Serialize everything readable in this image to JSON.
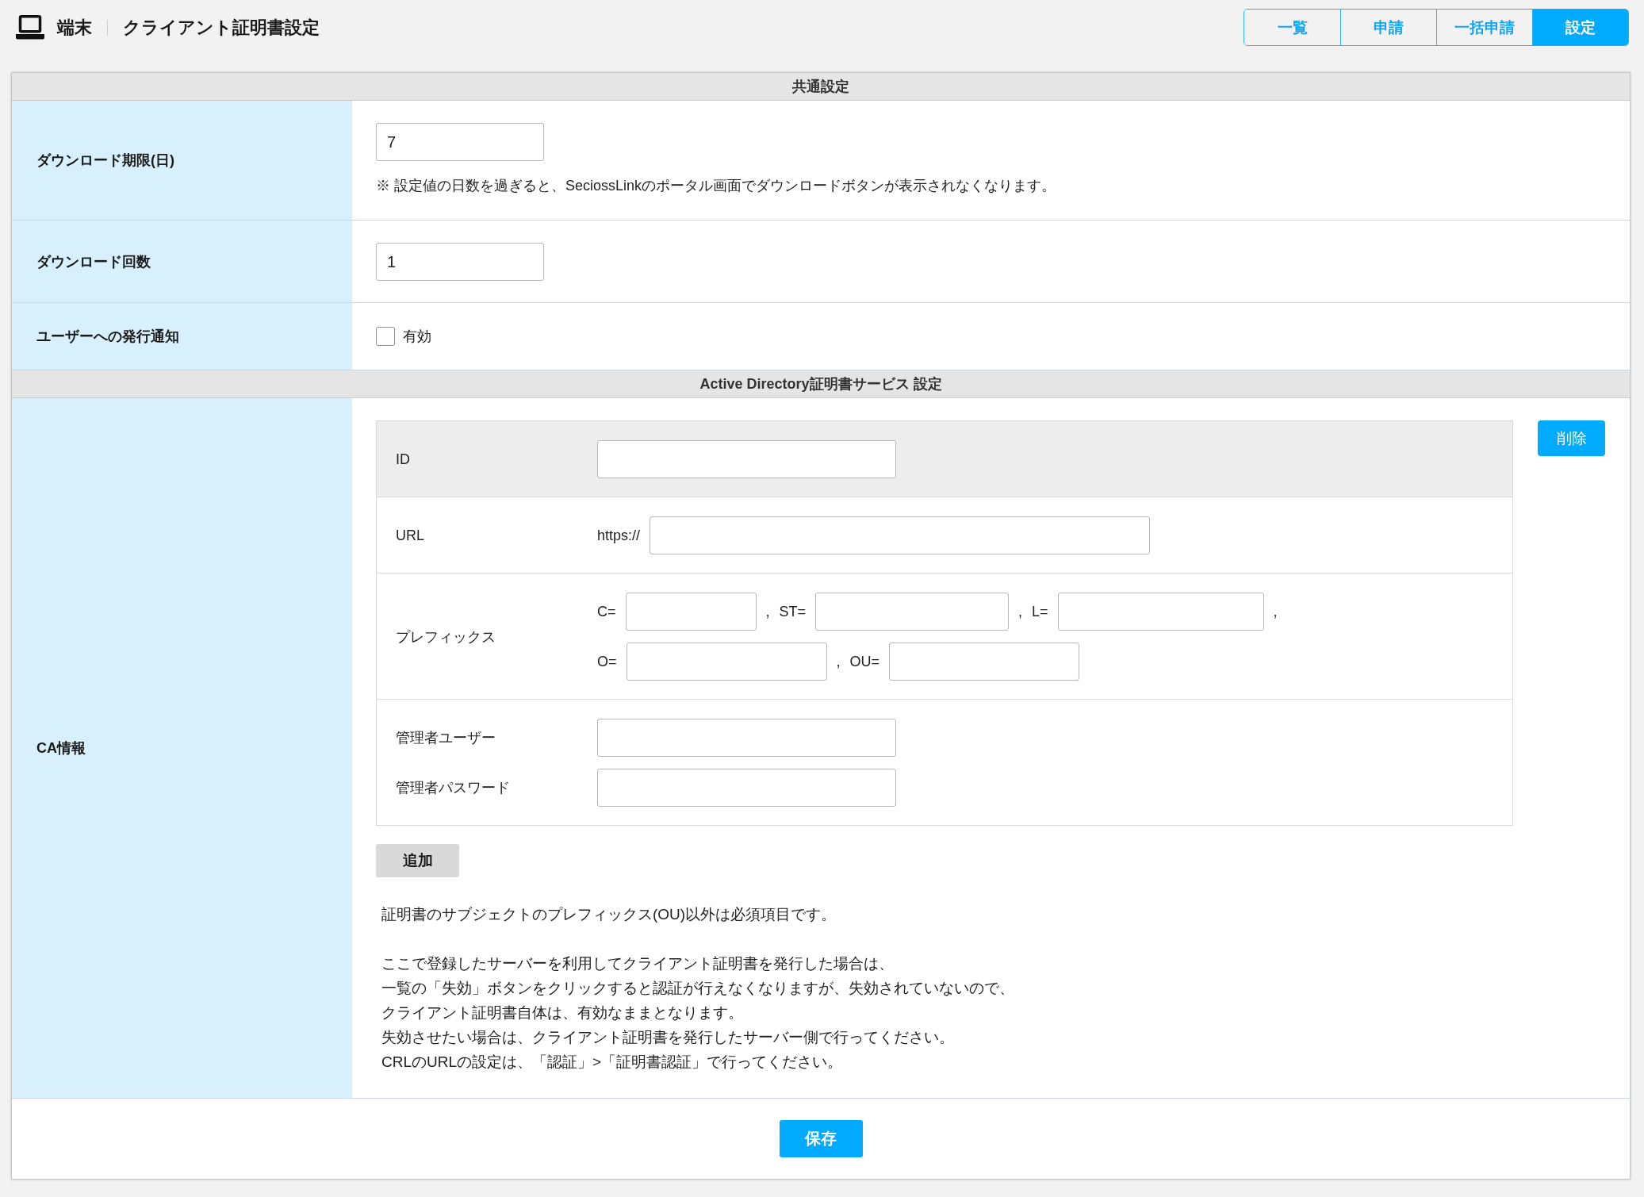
{
  "header": {
    "section": "端末",
    "title": "クライアント証明書設定"
  },
  "tabs": [
    {
      "label": "一覧",
      "selected": false
    },
    {
      "label": "申請",
      "selected": false
    },
    {
      "label": "一括申請",
      "selected": false
    },
    {
      "label": "設定",
      "selected": true
    }
  ],
  "sections": [
    {
      "title": "共通設定",
      "rows": [
        {
          "kind": "input",
          "label": "ダウンロード期限(日)",
          "value": "7",
          "note": "※ 設定値の日数を過ぎると、SeciossLinkのポータル画面でダウンロードボタンが表示されなくなります。"
        },
        {
          "kind": "input",
          "label": "ダウンロード回数",
          "value": "1"
        },
        {
          "kind": "checkbox",
          "label": "ユーザーへの発行通知",
          "option": "有効",
          "checked": false
        }
      ]
    },
    {
      "title": "Active Directory証明書サービス 設定",
      "rows": [
        {
          "kind": "ca",
          "label": "CA情報",
          "ca_table": {
            "groups": [
              {
                "highlighted": true,
                "entries": [
                  {
                    "label": "ID",
                    "lines": [
                      {
                        "parts": [
                          {
                            "kind": "field"
                          }
                        ]
                      }
                    ]
                  }
                ]
              },
              {
                "highlighted": false,
                "entries": [
                  {
                    "label": "URL",
                    "lines": [
                      {
                        "parts": [
                          {
                            "kind": "text",
                            "text": "https://"
                          },
                          {
                            "kind": "field"
                          }
                        ]
                      }
                    ]
                  }
                ]
              },
              {
                "highlighted": false,
                "entries": [
                  {
                    "label": "プレフィックス",
                    "lines": [
                      {
                        "parts": [
                          {
                            "kind": "text",
                            "text": "C="
                          },
                          {
                            "kind": "field"
                          },
                          {
                            "kind": "text",
                            "text": ","
                          },
                          {
                            "kind": "text",
                            "text": "ST="
                          },
                          {
                            "kind": "field"
                          },
                          {
                            "kind": "text",
                            "text": ","
                          },
                          {
                            "kind": "text",
                            "text": "L="
                          },
                          {
                            "kind": "field"
                          },
                          {
                            "kind": "text",
                            "text": ","
                          }
                        ]
                      },
                      {
                        "parts": [
                          {
                            "kind": "text",
                            "text": "O="
                          },
                          {
                            "kind": "field"
                          },
                          {
                            "kind": "text",
                            "text": ","
                          },
                          {
                            "kind": "text",
                            "text": "OU="
                          },
                          {
                            "kind": "field"
                          }
                        ]
                      }
                    ]
                  }
                ]
              },
              {
                "highlighted": false,
                "entries": [
                  {
                    "label": "管理者ユーザー",
                    "lines": [
                      {
                        "parts": [
                          {
                            "kind": "field"
                          }
                        ]
                      }
                    ]
                  },
                  {
                    "label": "管理者パスワード",
                    "lines": [
                      {
                        "parts": [
                          {
                            "kind": "field"
                          }
                        ]
                      }
                    ]
                  }
                ]
              }
            ]
          },
          "delete_button": "削除",
          "add_button": "追加",
          "notes": [
            {
              "lines": [
                "証明書のサブジェクトのプレフィックス(OU)以外は必須項目です。"
              ]
            },
            {
              "lines": [
                "ここで登録したサーバーを利用してクライアント証明書を発行した場合は、",
                "一覧の「失効」ボタンをクリックすると認証が行えなくなりますが、失効されていないので、",
                "クライアント証明書自体は、有効なままとなります。",
                "失効させたい場合は、クライアント証明書を発行したサーバー側で行ってください。",
                "CRLのURLの設定は、「認証」>「証明書認証」で行ってください。"
              ]
            }
          ]
        }
      ]
    }
  ],
  "save_button": "保存"
}
